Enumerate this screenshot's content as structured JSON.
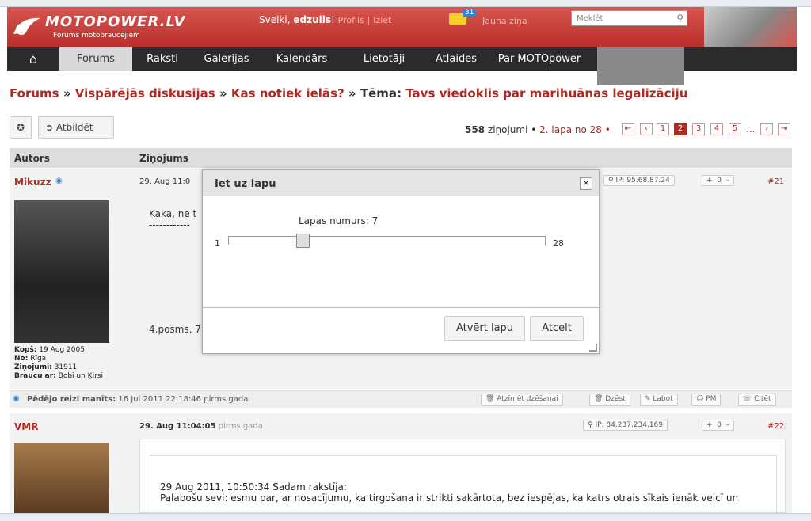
{
  "header": {
    "logo_name": "MOTOPOWER.LV",
    "logo_sub": "Forums motobraucējiem",
    "greeting": "Sveiki,",
    "username": "edzulis",
    "greet_end": "!",
    "profile_link": "Profils",
    "sep": "|",
    "logout_link": "Iziet",
    "msg_count": "31",
    "msg_text": "Jauna ziņa",
    "search_placeholder": "Meklēt"
  },
  "nav": {
    "items": [
      "Forums",
      "Raksti",
      "Galerijas",
      "Kalendārs",
      "Lietotāji",
      "Atlaides",
      "Par MOTOpower"
    ]
  },
  "breadcrumb": {
    "forum": "Forums",
    "sep1": "»",
    "general": "Vispārējās diskusijas",
    "sep2": "»",
    "section": "Kas notiek ielās?",
    "sep3": "»",
    "topic_prefix": "Tēma:",
    "topic": "Tavs viedoklis par marihuānas legalizāciju"
  },
  "toolbar": {
    "reply_label": "Atbildēt"
  },
  "pager": {
    "count": "558",
    "count_label": "ziņojumi •",
    "page_label": "2. lapa no 28 •",
    "pages": [
      "1",
      "2",
      "3",
      "4",
      "5"
    ],
    "ellipsis": "..."
  },
  "table": {
    "col_author": "Autors",
    "col_post": "Ziņojums"
  },
  "posts": [
    {
      "author": "Mikuzz",
      "date": "29. Aug 11:0",
      "ip": "IP: 95.68.87.24",
      "vote": "0",
      "num": "#21",
      "content_line1": "Kaka, ne t",
      "content_line2": "------------",
      "content_line3": "4.posms, 7",
      "since_label": "Kopš:",
      "since": "19 Aug 2005",
      "from_label": "No:",
      "from": "Rīga",
      "posts_label": "Ziņojumi:",
      "posts_count": "31911",
      "bike_label": "Braucu ar:",
      "bike": "Bobi un Ķirsi",
      "last_seen_label": "Pēdējo reizi manīts:",
      "last_seen": "16 Jul 2011 22:18:46",
      "last_seen_suffix": "pirms gada",
      "actions": [
        "Atzīmēt dzēšanai",
        "Dzēst",
        "Labot",
        "PM",
        "Citēt"
      ]
    },
    {
      "author": "VMR",
      "date": "29. Aug 11:04:05",
      "date_suffix": "pirms gada",
      "ip": "IP: 84.237.234.169",
      "vote": "0",
      "num": "#22",
      "quote_head": "29 Aug 2011, 10:50:34 Sadam rakstīja:",
      "quote_body": "Palabošu sevi: esmu par, ar nosacījumu, ka tirgošana ir strikti sakārtota, bez iespējas, ka katrs otrais sīkais ienāk veicī un"
    }
  ],
  "dialog": {
    "title": "Iet uz lapu",
    "label": "Lapas numurs: 7",
    "min": "1",
    "max": "28",
    "open_btn": "Atvērt lapu",
    "cancel_btn": "Atcelt",
    "value": 7
  },
  "colors": {
    "accent": "#b02a24",
    "header_red": "#d9554f",
    "nav_dark": "#2b2b2b"
  }
}
